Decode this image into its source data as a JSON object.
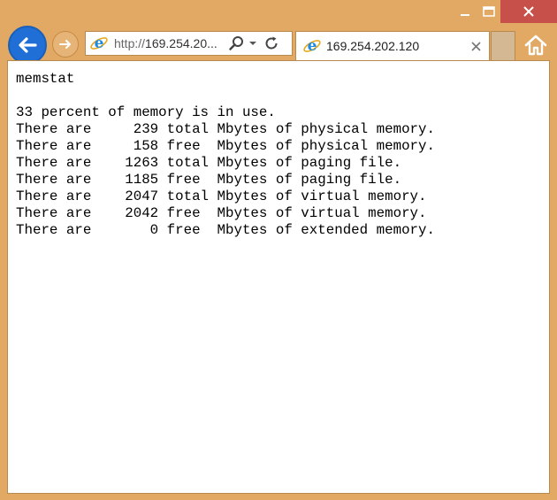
{
  "browser": {
    "address": {
      "protocol": "http://",
      "host": "169.254.20..."
    },
    "tab": {
      "title": "169.254.202.120"
    }
  },
  "page": {
    "lines": [
      "memstat",
      "",
      "33 percent of memory is in use.",
      "There are     239 total Mbytes of physical memory.",
      "There are     158 free  Mbytes of physical memory.",
      "There are    1263 total Mbytes of paging file.",
      "There are    1185 free  Mbytes of paging file.",
      "There are    2047 total Mbytes of virtual memory.",
      "There are    2042 free  Mbytes of virtual memory.",
      "There are       0 free  Mbytes of extended memory."
    ]
  },
  "colors": {
    "frame": "#e1a964",
    "close_button": "#c7504a",
    "back_button": "#1f6fd6"
  },
  "icons": {
    "back": "back-arrow-icon",
    "forward": "forward-arrow-icon",
    "search": "search-icon",
    "dropdown": "chevron-down-icon",
    "refresh": "refresh-icon",
    "close_tab": "close-icon",
    "home": "home-icon",
    "ie": "ie-logo-icon"
  }
}
